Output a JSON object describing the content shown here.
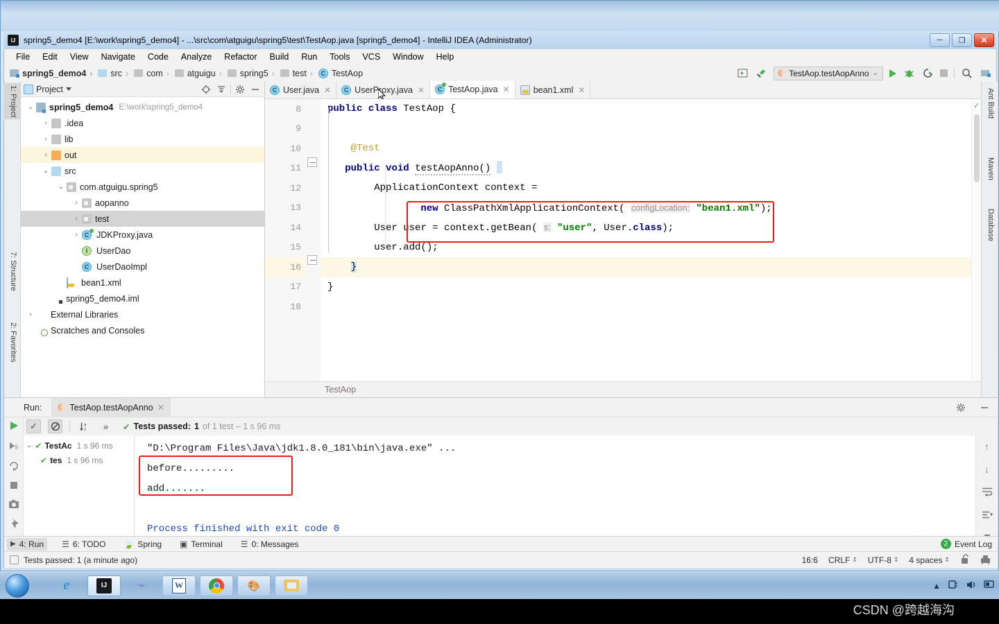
{
  "window": {
    "title": "spring5_demo4 [E:\\work\\spring5_demo4] - ...\\src\\com\\atguigu\\spring5\\test\\TestAop.java [spring5_demo4] - IntelliJ IDEA (Administrator)",
    "minimize": "─",
    "maximize": "❐",
    "close": "✕"
  },
  "menubar": [
    {
      "label": "File"
    },
    {
      "label": "Edit"
    },
    {
      "label": "View"
    },
    {
      "label": "Navigate"
    },
    {
      "label": "Code"
    },
    {
      "label": "Analyze"
    },
    {
      "label": "Refactor"
    },
    {
      "label": "Build"
    },
    {
      "label": "Run"
    },
    {
      "label": "Tools"
    },
    {
      "label": "VCS"
    },
    {
      "label": "Window"
    },
    {
      "label": "Help"
    }
  ],
  "breadcrumbs": [
    {
      "label": "spring5_demo4",
      "icon": "module-icon"
    },
    {
      "label": "src",
      "icon": "folder-icon"
    },
    {
      "label": "com",
      "icon": "package-icon"
    },
    {
      "label": "atguigu",
      "icon": "package-icon"
    },
    {
      "label": "spring5",
      "icon": "package-icon"
    },
    {
      "label": "test",
      "icon": "package-icon"
    },
    {
      "label": "TestAop",
      "icon": "class-icon"
    }
  ],
  "toolbar": {
    "run_config": "TestAop.testAopAnno",
    "run_label": "Run",
    "debug_label": "Debug",
    "coverage_label": "Run with Coverage",
    "stop_label": "Stop",
    "search_label": "Search Everywhere"
  },
  "left_strip": [
    {
      "label": "1: Project",
      "active": true
    },
    {
      "label": "7: Structure",
      "active": false
    },
    {
      "label": "2: Favorites",
      "active": false
    }
  ],
  "right_strip": [
    {
      "label": "Ant Build"
    },
    {
      "label": "Maven"
    },
    {
      "label": "Database"
    }
  ],
  "project_panel": {
    "title": "Project",
    "locate_icon": "crosshair-icon",
    "collapse_icon": "collapse-all-icon",
    "settings_icon": "gear-icon",
    "hide_icon": "minimize-icon",
    "tree": [
      {
        "label": "spring5_demo4",
        "path": "E:\\work\\spring5_demo4",
        "indent": 0,
        "arrow": "v",
        "icon": "module-icon",
        "bold": true,
        "state": "none"
      },
      {
        "label": ".idea",
        "path": "",
        "indent": 1,
        "arrow": ">",
        "icon": "folder-grey-icon",
        "bold": false,
        "state": "none"
      },
      {
        "label": "lib",
        "path": "",
        "indent": 1,
        "arrow": ">",
        "icon": "folder-grey-icon",
        "bold": false,
        "state": "none"
      },
      {
        "label": "out",
        "path": "",
        "indent": 1,
        "arrow": ">",
        "icon": "folder-orange-icon",
        "bold": false,
        "state": "highlight"
      },
      {
        "label": "src",
        "path": "",
        "indent": 1,
        "arrow": "v",
        "icon": "folder-blue-icon",
        "bold": false,
        "state": "none"
      },
      {
        "label": "com.atguigu.spring5",
        "path": "",
        "indent": 2,
        "arrow": "v",
        "icon": "package-icon",
        "bold": false,
        "state": "none"
      },
      {
        "label": "aopanno",
        "path": "",
        "indent": 3,
        "arrow": ">",
        "icon": "package-icon",
        "bold": false,
        "state": "none"
      },
      {
        "label": "test",
        "path": "",
        "indent": 3,
        "arrow": ">",
        "icon": "package-icon",
        "bold": false,
        "state": "selected"
      },
      {
        "label": "JDKProxy.java",
        "path": "",
        "indent": 3,
        "arrow": ">",
        "icon": "class-runnable-icon",
        "bold": false,
        "state": "none"
      },
      {
        "label": "UserDao",
        "path": "",
        "indent": 4,
        "arrow": "",
        "icon": "interface-icon",
        "bold": false,
        "state": "none"
      },
      {
        "label": "UserDaoImpl",
        "path": "",
        "indent": 4,
        "arrow": "",
        "icon": "class-icon",
        "bold": false,
        "state": "none"
      },
      {
        "label": "bean1.xml",
        "path": "",
        "indent": 2,
        "arrow": "",
        "icon": "xml-icon",
        "bold": false,
        "state": "none"
      },
      {
        "label": "spring5_demo4.iml",
        "path": "",
        "indent": 1,
        "arrow": "",
        "icon": "iml-icon",
        "bold": false,
        "state": "none"
      },
      {
        "label": "External Libraries",
        "path": "",
        "indent": 0,
        "arrow": ">",
        "icon": "library-icon",
        "bold": false,
        "state": "none"
      },
      {
        "label": "Scratches and Consoles",
        "path": "",
        "indent": 0,
        "arrow": "",
        "icon": "scratches-icon",
        "bold": false,
        "state": "none"
      }
    ]
  },
  "editor": {
    "tabs": [
      {
        "label": "User.java",
        "icon": "class-icon",
        "active": false
      },
      {
        "label": "UserProxy.java",
        "icon": "class-icon",
        "active": false
      },
      {
        "label": "TestAop.java",
        "icon": "class-runnable-icon",
        "active": true
      },
      {
        "label": "bean1.xml",
        "icon": "xml-icon",
        "active": false
      }
    ],
    "breadcrumb_bottom": "TestAop",
    "line_numbers": [
      "8",
      "9",
      "10",
      "11",
      "12",
      "13",
      "14",
      "15",
      "16",
      "17",
      "18"
    ],
    "lines": [
      {
        "n": "8",
        "text": "public class TestAop {"
      },
      {
        "n": "9",
        "text": ""
      },
      {
        "n": "10",
        "text": "    @Test"
      },
      {
        "n": "11",
        "text": "    public void testAopAnno() {"
      },
      {
        "n": "12",
        "text": "        ApplicationContext context ="
      },
      {
        "n": "13",
        "text": "                new ClassPathXmlApplicationContext( configLocation: \"bean1.xml\");"
      },
      {
        "n": "14",
        "text": "        User user = context.getBean( s: \"user\", User.class);"
      },
      {
        "n": "15",
        "text": "        user.add();"
      },
      {
        "n": "16",
        "text": "    }"
      },
      {
        "n": "17",
        "text": "}"
      },
      {
        "n": "18",
        "text": ""
      }
    ],
    "tokens": {
      "kw_public": "public",
      "kw_class": "class",
      "cls_TestAop": "TestAop",
      "brace_open": "{",
      "anno_test": "@Test",
      "kw_void": "void",
      "method_name": "testAopAnno()",
      "type_appctx": "ApplicationContext",
      "var_context": "context =",
      "kw_new": "new",
      "cls_cpxac": "ClassPathXmlApplicationContext(",
      "hint_configLocation": "configLocation:",
      "str_bean1": "\"bean1.xml\"",
      "close_paren_semi": ");",
      "type_user": "User",
      "var_user": "user = context.getBean(",
      "hint_s": "s:",
      "str_user": "\"user\"",
      "user_dot": ", User.",
      "kw_classlit": "class",
      "call_add": "user.add();",
      "brace_close_inner": "}",
      "brace_close_outer": "}"
    }
  },
  "run_window": {
    "label": "Run:",
    "tab_label": "TestAop.testAopAnno",
    "toolbar": {
      "rerun_icon": "rerun-icon",
      "show_passed_icon": "check-icon",
      "hide_ignored_icon": "no-entry-icon",
      "sort_alpha_icon": "sort-alpha-icon",
      "more_icon": "chevrons-right-icon"
    },
    "status": {
      "prefix": "Tests passed:",
      "count": "1",
      "detail": "of 1 test – 1 s 96 ms"
    },
    "test_tree": [
      {
        "label": "TestAc",
        "time": "1 s 96 ms",
        "indent": 0
      },
      {
        "label": "tes",
        "time": "1 s 96 ms",
        "indent": 1
      }
    ],
    "console": [
      {
        "text": "\"D:\\Program Files\\Java\\jdk1.8.0_181\\bin\\java.exe\" ...",
        "style": "cmd"
      },
      {
        "text": "before.........",
        "style": "plain"
      },
      {
        "text": "add.......",
        "style": "plain"
      },
      {
        "text": "",
        "style": "plain"
      },
      {
        "text": "Process finished with exit code 0",
        "style": "blue"
      }
    ],
    "left_icons": [
      "rerun-icon",
      "rerun-failed-icon",
      "stop-icon",
      "screenshot-icon",
      "toggle-icon",
      "export-icon",
      "more-icon"
    ],
    "right_icons": [
      "arrow-up-icon",
      "arrow-down-icon",
      "soft-wrap-icon",
      "scroll-to-end-icon",
      "print-icon",
      "trash-icon"
    ],
    "settings_icon": "gear-icon",
    "hide_icon": "minimize-icon"
  },
  "bottom_bar": {
    "items": [
      {
        "label": "4: Run",
        "num": "4",
        "icon": "play-icon",
        "active": true
      },
      {
        "label": "6: TODO",
        "num": "6",
        "icon": "list-icon",
        "active": false
      },
      {
        "label": "Spring",
        "num": "",
        "icon": "leaf-icon",
        "active": false
      },
      {
        "label": "Terminal",
        "num": "",
        "icon": "terminal-icon",
        "active": false
      },
      {
        "label": "0: Messages",
        "num": "0",
        "icon": "messages-icon",
        "active": false
      }
    ],
    "event_log": "Event Log",
    "event_count": "2"
  },
  "status_bar": {
    "message": "Tests passed: 1 (a minute ago)",
    "caret": "16:6",
    "line_sep": "CRLF",
    "encoding": "UTF-8",
    "indent": "4 spaces",
    "lock_icon": "unlock-icon",
    "vcs_icon": "vcs-icon"
  },
  "taskbar": {
    "start": "start-orb",
    "buttons": [
      {
        "name": "internet-explorer",
        "glyph": "e",
        "pressed": false
      },
      {
        "name": "intellij-idea",
        "glyph": "IJ",
        "pressed": true
      },
      {
        "name": "navicat",
        "glyph": "⌁",
        "pressed": false
      },
      {
        "name": "microsoft-word",
        "glyph": "W",
        "pressed": false
      },
      {
        "name": "google-chrome",
        "glyph": "◉",
        "pressed": false
      },
      {
        "name": "paint",
        "glyph": "🎨",
        "pressed": false
      },
      {
        "name": "file-explorer",
        "glyph": "🗂",
        "pressed": false
      }
    ],
    "tray": [
      "show-hidden-icons",
      "network-icon",
      "volume-icon",
      "action-center-icon"
    ]
  },
  "watermark": "CSDN @跨越海沟",
  "colors": {
    "accent_red": "#f01b1b",
    "keyword_blue": "#000080",
    "string_green": "#008000",
    "annotation_gold": "#bba035",
    "console_blue": "#1a49b8",
    "highlight_yellow": "#fdf8e3",
    "test_green": "#59a14f"
  }
}
